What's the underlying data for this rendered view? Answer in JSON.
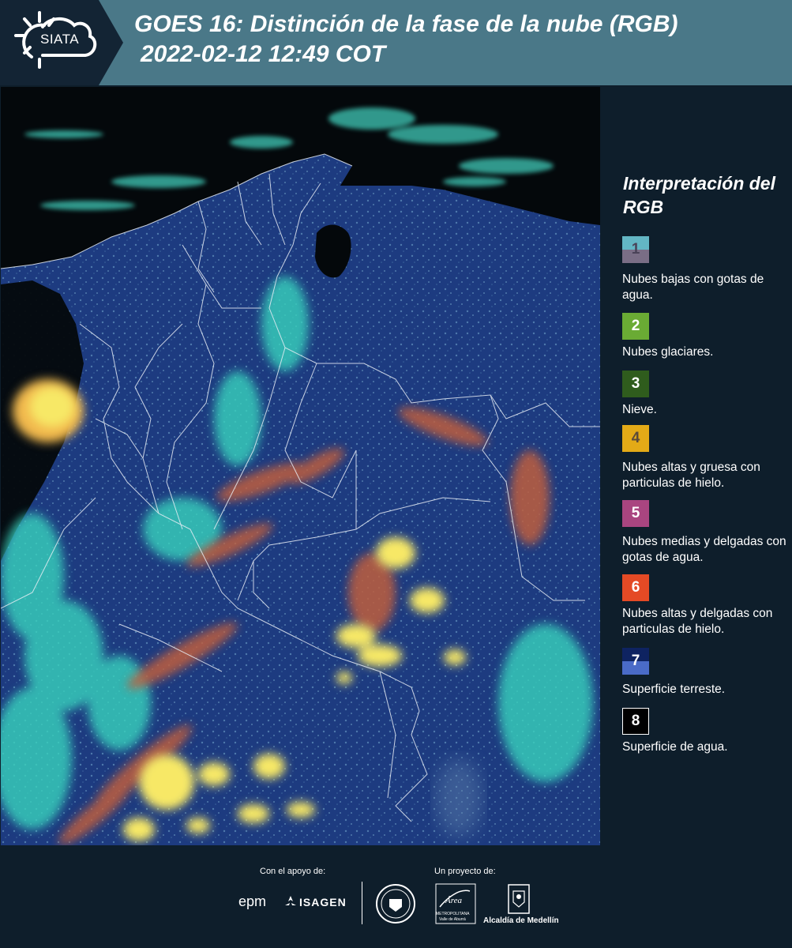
{
  "header": {
    "logo_text": "SIATA",
    "title_line1": "GOES 16: Distinción de la fase de la nube (RGB)",
    "title_line2": "2022-02-12 12:49 COT"
  },
  "legend": {
    "title": "Interpretación del RGB",
    "items": [
      {
        "number": "1",
        "color_top": "#63b6c4",
        "color_bottom": "#7a6e86",
        "label": "Nubes bajas con gotas de agua."
      },
      {
        "number": "2",
        "color": "#6aab34",
        "label": "Nubes glaciares."
      },
      {
        "number": "3",
        "color": "#2f5c1d",
        "label": "Nieve."
      },
      {
        "number": "4",
        "color": "#e3aa17",
        "label": "Nubes altas y gruesa con particulas de hielo."
      },
      {
        "number": "5",
        "color": "#a94580",
        "label": "Nubes medias y delgadas con gotas de agua."
      },
      {
        "number": "6",
        "color": "#e44a25",
        "label": "Nubes altas y delgadas con particulas de hielo."
      },
      {
        "number": "7",
        "color_top": "#0e2361",
        "color_bottom": "#4a6bc7",
        "label": "Superficie terreste."
      },
      {
        "number": "8",
        "color": "#000000",
        "border": "#ffffff",
        "label": "Superficie de agua."
      }
    ]
  },
  "footer": {
    "support_label": "Con el apoyo de:",
    "project_label": "Un proyecto de:",
    "sponsor_1": "epm",
    "sponsor_2": "ISAGEN",
    "area_logo_text": "Área",
    "area_logo_sub": "METROPOLITANA",
    "area_logo_sub2": "Valle de Aburrá",
    "alcaldia_label": "Alcaldía de Medellín"
  },
  "map": {
    "description_colors": {
      "land": "#1f3f85",
      "water": "#05090d",
      "low_cloud": "#49d6c3",
      "thick_ice_cloud": "#f6e05a",
      "thin_ice_cloud": "#c2613e",
      "border": "#e8eef5"
    }
  }
}
